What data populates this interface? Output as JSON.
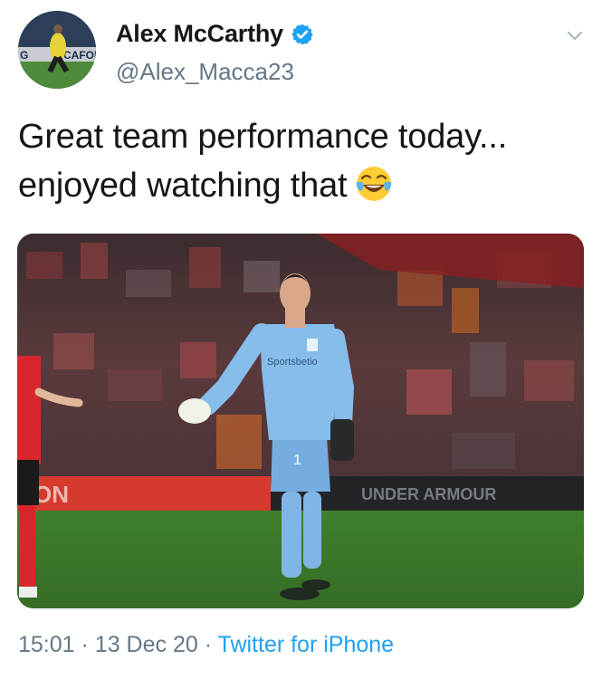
{
  "tweet": {
    "author": {
      "display_name": "Alex McCarthy",
      "handle": "@Alex_Macca23",
      "verified": true,
      "avatar_icon": "profile-photo"
    },
    "text_line1": "Great team performance today...",
    "text_line2": "enjoyed watching that",
    "emoji": "face-with-tears-of-joy",
    "media": {
      "type": "photo",
      "description_icon": "goalkeeper-photo",
      "shirt_number": "1",
      "kit_sponsor": "Sportsbetio"
    },
    "meta": {
      "time": "15:01",
      "separator": "·",
      "date": "13 Dec 20",
      "source": "Twitter for iPhone"
    }
  },
  "colors": {
    "text_primary": "#14171a",
    "text_secondary": "#657786",
    "link": "#1da1f2",
    "verified": "#1da1f2",
    "keeper_kit": "#7fb6e6",
    "pitch": "#3f7a2c"
  }
}
